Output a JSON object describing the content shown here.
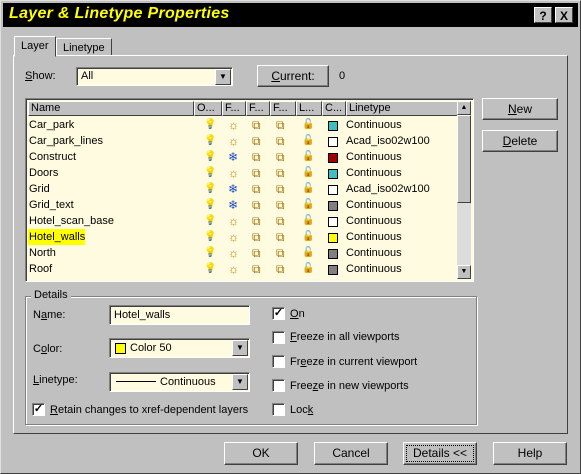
{
  "window": {
    "title": "Layer & Linetype Properties",
    "help_btn": "?",
    "close_btn": "X"
  },
  "tabs": [
    {
      "label": "Layer",
      "active": true
    },
    {
      "label": "Linetype",
      "active": false
    }
  ],
  "show": {
    "label": "Show:",
    "value": "All"
  },
  "current": {
    "button": "Current:",
    "value": "0"
  },
  "columns": [
    "Name",
    "O...",
    "F...",
    "F...",
    "F...",
    "L...",
    "C...",
    "Linetype"
  ],
  "layers": [
    {
      "name": "Car_park",
      "on": "yellow",
      "freeze": "sun",
      "color": "#40c0c0",
      "linetype": "Continuous",
      "selected": false
    },
    {
      "name": "Car_park_lines",
      "on": "yellow",
      "freeze": "sun",
      "color": "#ffffff",
      "linetype": "Acad_iso02w100",
      "selected": false
    },
    {
      "name": "Construct",
      "on": "yellow",
      "freeze": "snow",
      "color": "#a00000",
      "linetype": "Continuous",
      "selected": false
    },
    {
      "name": "Doors",
      "on": "yellow",
      "freeze": "sun",
      "color": "#40c0c0",
      "linetype": "Continuous",
      "selected": false
    },
    {
      "name": "Grid",
      "on": "blue",
      "freeze": "snow",
      "color": "#ffffff",
      "linetype": "Acad_iso02w100",
      "selected": false
    },
    {
      "name": "Grid_text",
      "on": "blue",
      "freeze": "snow",
      "color": "#808080",
      "linetype": "Continuous",
      "selected": false
    },
    {
      "name": "Hotel_scan_base",
      "on": "blue",
      "freeze": "sun",
      "color": "#ffffff",
      "linetype": "Continuous",
      "selected": false
    },
    {
      "name": "Hotel_walls",
      "on": "yellow",
      "freeze": "sun",
      "color": "#ffff00",
      "linetype": "Continuous",
      "selected": true
    },
    {
      "name": "North",
      "on": "blue",
      "freeze": "sun",
      "color": "#808080",
      "linetype": "Continuous",
      "selected": false
    },
    {
      "name": "Roof",
      "on": "yellow",
      "freeze": "sun",
      "color": "#808080",
      "linetype": "Continuous",
      "selected": false
    }
  ],
  "side_buttons": {
    "new": "New",
    "delete": "Delete"
  },
  "details": {
    "legend": "Details",
    "name_label": "Name:",
    "name_value": "Hotel_walls",
    "color_label": "Color:",
    "color_value": "Color 50",
    "color_swatch": "#ffff00",
    "linetype_label": "Linetype:",
    "linetype_value": "Continuous",
    "retain_label": "Retain changes to xref-dependent layers",
    "retain_checked": true,
    "on_label": "On",
    "on_checked": true,
    "freeze_all_label": "Freeze in all viewports",
    "freeze_current_label": "Freeze in current viewport",
    "freeze_new_label": "Freeze in new viewports",
    "lock_label": "Lock"
  },
  "footer": {
    "ok": "OK",
    "cancel": "Cancel",
    "details": "Details <<",
    "help": "Help"
  }
}
